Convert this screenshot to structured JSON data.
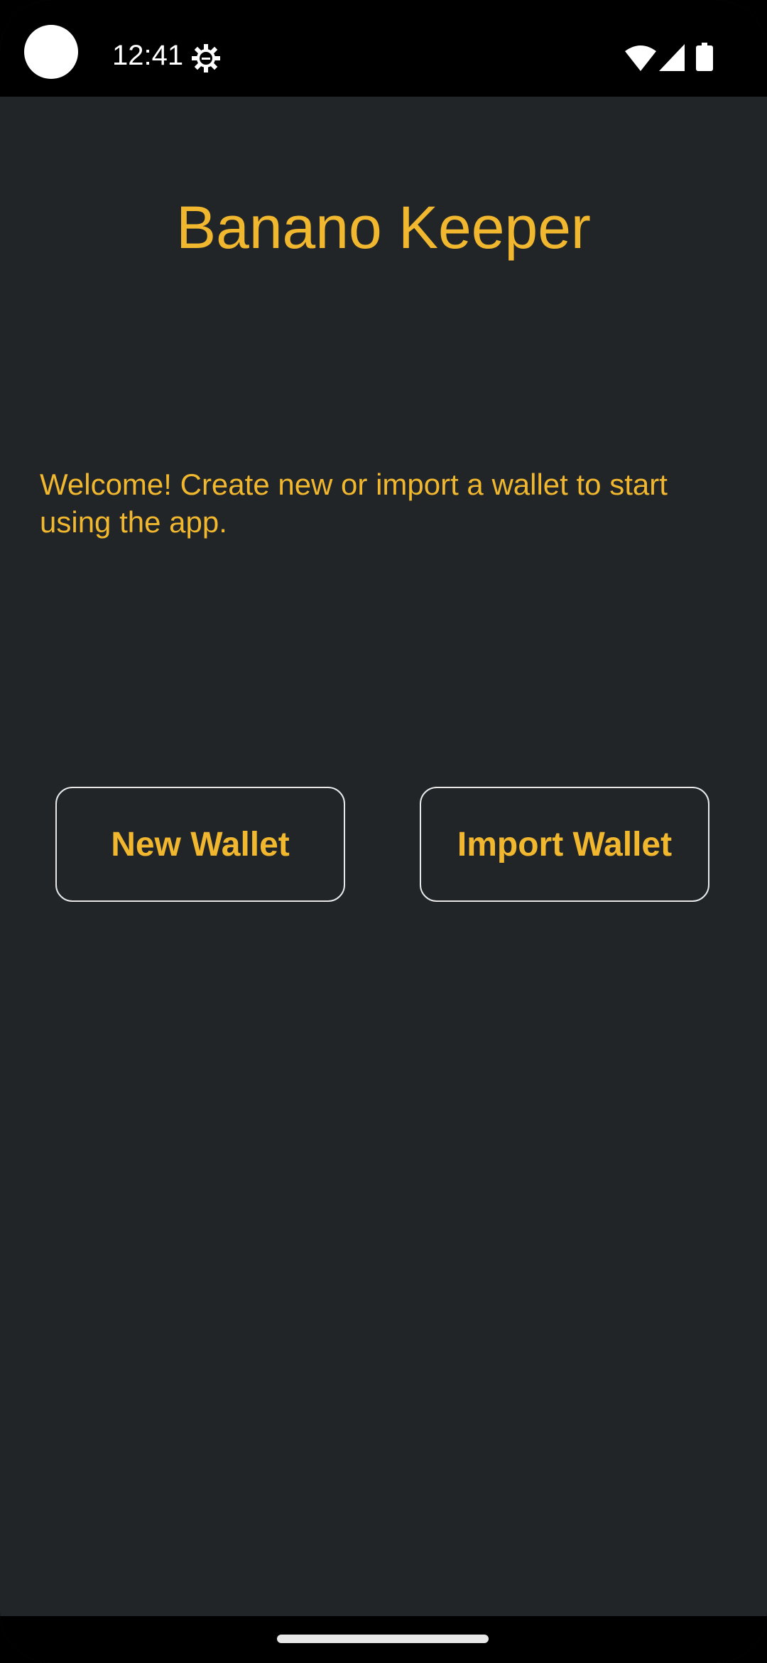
{
  "status_bar": {
    "time": "12:41",
    "icons": [
      "camera-cutout",
      "gear-icon",
      "wifi-icon",
      "signal-icon",
      "battery-icon"
    ]
  },
  "app": {
    "title": "Banano Keeper",
    "welcome_text": "Welcome! Create new or import a wallet to start using the app.",
    "buttons": {
      "new_wallet": "New Wallet",
      "import_wallet": "Import Wallet"
    }
  },
  "colors": {
    "background": "#222528",
    "accent": "#f0b72f",
    "button_border": "#e8e8e8",
    "status_bar": "#000000"
  }
}
